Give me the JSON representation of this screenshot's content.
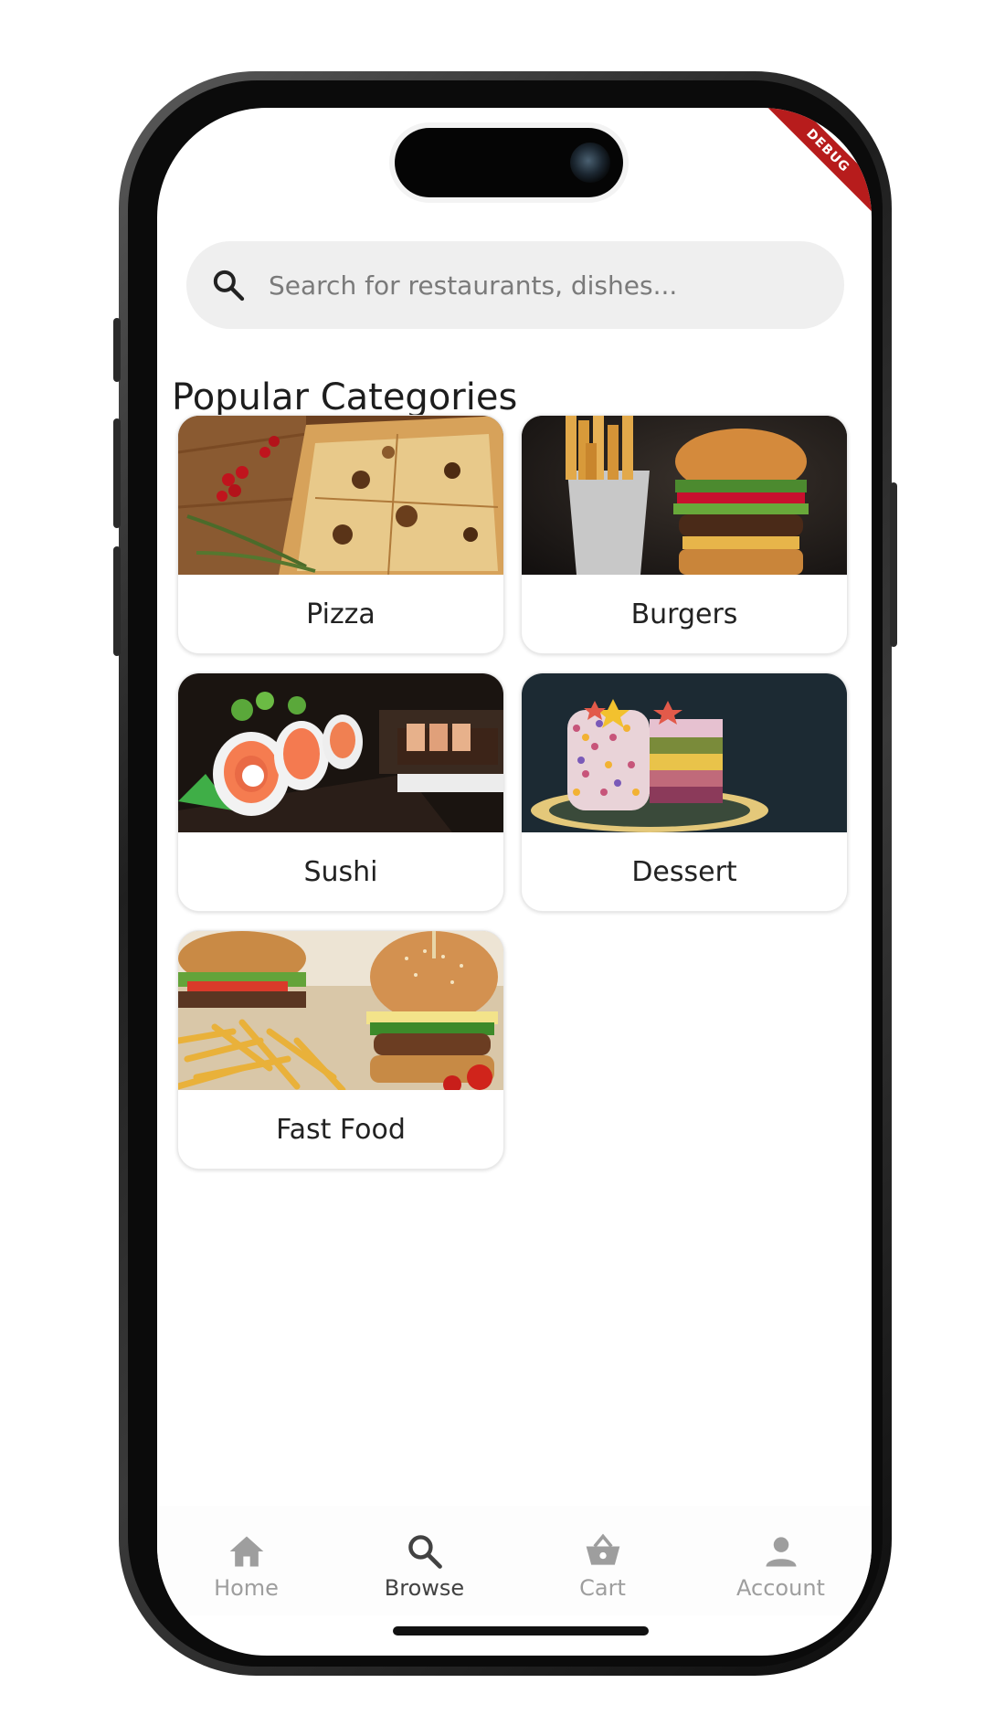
{
  "status": {
    "debug_banner": "DEBUG"
  },
  "search": {
    "placeholder": "Search for restaurants, dishes..."
  },
  "section": {
    "title": "Popular Categories"
  },
  "categories": [
    {
      "label": "Pizza"
    },
    {
      "label": "Burgers"
    },
    {
      "label": "Sushi"
    },
    {
      "label": "Dessert"
    },
    {
      "label": "Fast Food"
    }
  ],
  "nav": {
    "items": [
      {
        "label": "Home",
        "icon": "home-icon"
      },
      {
        "label": "Browse",
        "icon": "search-icon"
      },
      {
        "label": "Cart",
        "icon": "basket-icon"
      },
      {
        "label": "Account",
        "icon": "person-icon"
      }
    ],
    "active": "Browse"
  },
  "colors": {
    "debug_banner": "#b71c1c",
    "search_bg": "#efefef",
    "nav_active": "#424242",
    "nav_inactive": "#9e9e9e"
  }
}
